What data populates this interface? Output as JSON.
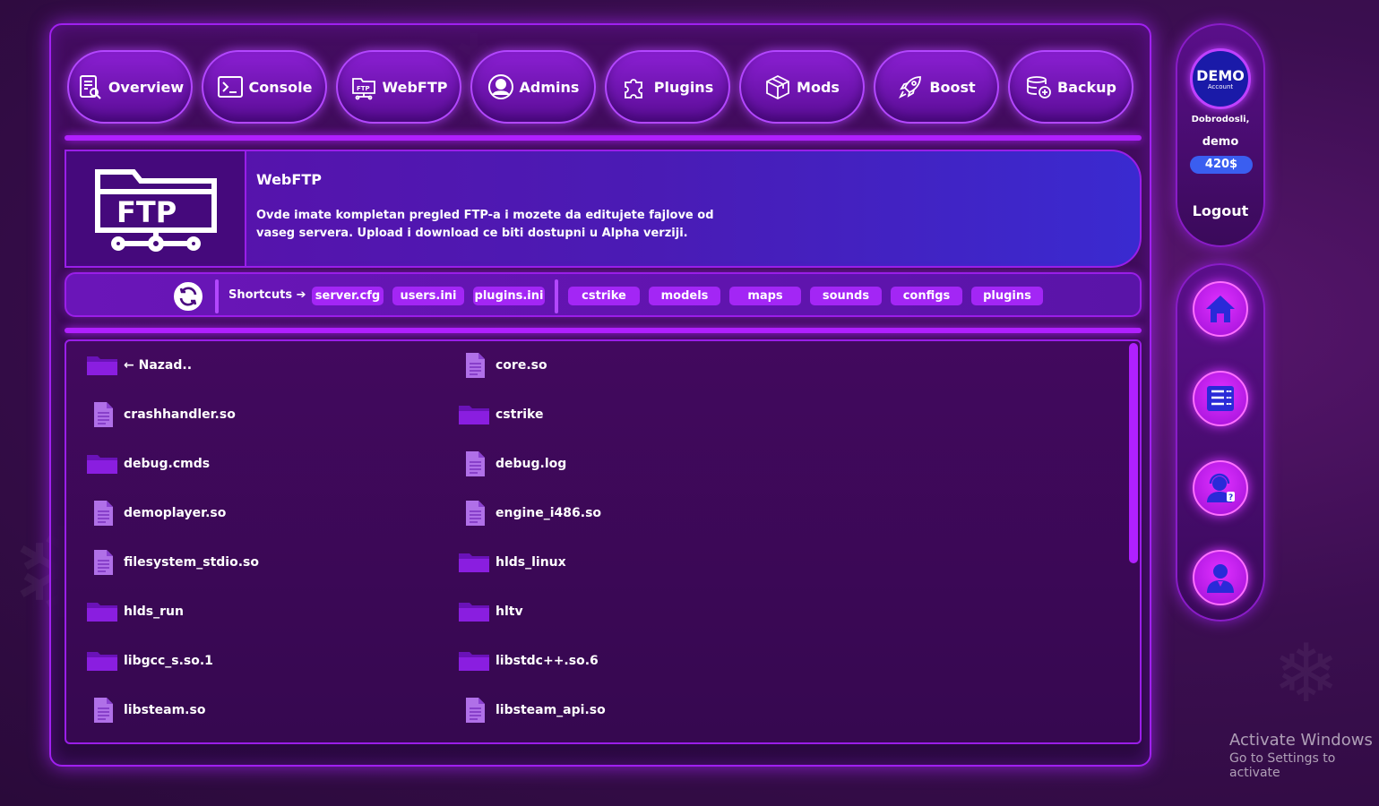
{
  "nav": [
    {
      "label": "Overview",
      "icon": "overview-icon"
    },
    {
      "label": "Console",
      "icon": "console-icon"
    },
    {
      "label": "WebFTP",
      "icon": "ftp-icon"
    },
    {
      "label": "Admins",
      "icon": "admins-icon"
    },
    {
      "label": "Plugins",
      "icon": "plugins-icon"
    },
    {
      "label": "Mods",
      "icon": "mods-icon"
    },
    {
      "label": "Boost",
      "icon": "boost-icon"
    },
    {
      "label": "Backup",
      "icon": "backup-icon"
    }
  ],
  "banner": {
    "icon_text": "FTP",
    "title": "WebFTP",
    "description": "Ovde imate kompletan pregled FTP-a i mozete da editujete fajlove od vaseg servera. Upload i download ce biti dostupni u Alpha verziji."
  },
  "shortcuts": {
    "label": "Shortcuts ➔",
    "files": [
      "server.cfg",
      "users.ini",
      "plugins.ini"
    ],
    "folders": [
      "cstrike",
      "models",
      "maps",
      "sounds",
      "configs",
      "plugins"
    ]
  },
  "files": [
    {
      "name": "← Nazad..",
      "type": "folder"
    },
    {
      "name": "core.so",
      "type": "file"
    },
    {
      "name": "crashhandler.so",
      "type": "file"
    },
    {
      "name": "cstrike",
      "type": "folder"
    },
    {
      "name": "debug.cmds",
      "type": "folder"
    },
    {
      "name": "debug.log",
      "type": "file"
    },
    {
      "name": "demoplayer.so",
      "type": "file"
    },
    {
      "name": "engine_i486.so",
      "type": "file"
    },
    {
      "name": "filesystem_stdio.so",
      "type": "file"
    },
    {
      "name": "hlds_linux",
      "type": "folder"
    },
    {
      "name": "hlds_run",
      "type": "folder"
    },
    {
      "name": "hltv",
      "type": "folder"
    },
    {
      "name": "libgcc_s.so.1",
      "type": "folder"
    },
    {
      "name": "libstdc++.so.6",
      "type": "folder"
    },
    {
      "name": "libsteam.so",
      "type": "file"
    },
    {
      "name": "libsteam_api.so",
      "type": "file"
    }
  ],
  "account": {
    "badge": "DEMO",
    "badge_sub": "Account",
    "welcome": "Dobrodosli,",
    "username": "demo",
    "balance": "420$",
    "logout": "Logout"
  },
  "side_buttons": [
    "home-icon",
    "server-list-icon",
    "support-icon",
    "profile-icon"
  ],
  "windows_notice": {
    "title": "Activate Windows",
    "subtitle": "Go to Settings to activate"
  },
  "colors": {
    "accent": "#b020ff",
    "chip": "#a326f5",
    "balance": "#3a5ef0"
  }
}
